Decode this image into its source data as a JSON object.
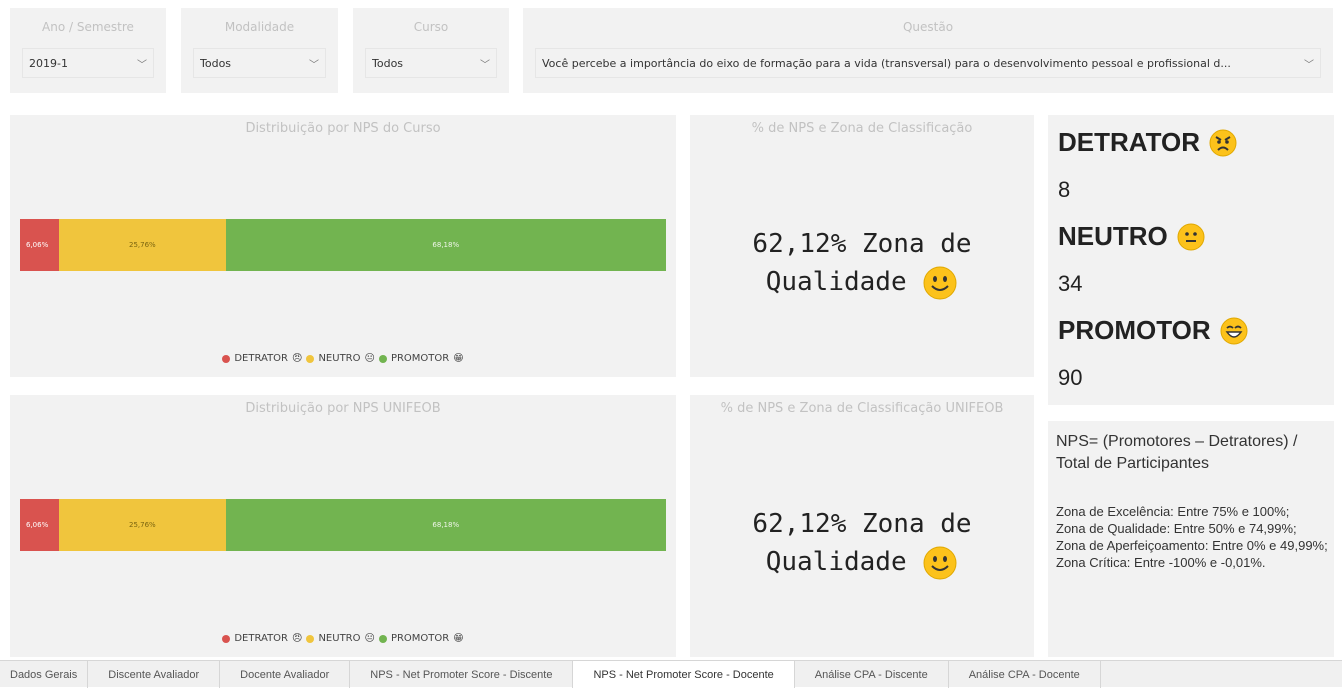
{
  "filters": {
    "ano": {
      "title": "Ano / Semestre",
      "value": "2019-1"
    },
    "modalidade": {
      "title": "Modalidade",
      "value": "Todos"
    },
    "curso": {
      "title": "Curso",
      "value": "Todos"
    },
    "questao": {
      "title": "Questão",
      "value": "Você percebe a importância do eixo de formação para a vida (transversal) para o desenvolvimento pessoal e profissional d..."
    }
  },
  "chart_curso": {
    "title": "Distribuição por NPS do Curso",
    "segments": [
      {
        "label": "6,06%",
        "value": 6.06
      },
      {
        "label": "25,76%",
        "value": 25.76
      },
      {
        "label": "68,18%",
        "value": 68.18
      }
    ]
  },
  "chart_unifeob": {
    "title": "Distribuição por NPS UNIFEOB",
    "segments": [
      {
        "label": "6,06%",
        "value": 6.06
      },
      {
        "label": "25,76%",
        "value": 25.76
      },
      {
        "label": "68,18%",
        "value": 68.18
      }
    ]
  },
  "legend": {
    "detrator": "DETRATOR",
    "neutro": "NEUTRO",
    "promotor": "PROMOTOR"
  },
  "colors": {
    "detrator": "#d9534f",
    "neutro": "#f0c53d",
    "promotor": "#72b450"
  },
  "zona_curso": {
    "title": "% de NPS e Zona de Classificação",
    "line1": "62,12% Zona de",
    "line2": "Qualidade"
  },
  "zona_unifeob": {
    "title": "% de NPS e Zona de Classificação UNIFEOB",
    "line1": "62,12% Zona de",
    "line2": "Qualidade"
  },
  "kpis": {
    "detrator_label": "DETRATOR",
    "detrator_value": "8",
    "neutro_label": "NEUTRO",
    "neutro_value": "34",
    "promotor_label": "PROMOTOR",
    "promotor_value": "90"
  },
  "info": {
    "formula": "NPS= (Promotores – Detratores) / Total de Participantes",
    "z1": "Zona de Excelência: Entre 75% e 100%;",
    "z2": "Zona de Qualidade: Entre 50% e 74,99%;",
    "z3": "Zona de Aperfeiçoamento: Entre 0% e 49,99%;",
    "z4": "Zona Crítica: Entre -100% e -0,01%."
  },
  "tabs": [
    "Dados Gerais",
    "Discente Avaliador",
    "Docente Avaliador",
    "NPS - Net Promoter Score - Discente",
    "NPS - Net Promoter Score - Docente",
    "Análise CPA - Discente",
    "Análise CPA - Docente"
  ],
  "chart_data": [
    {
      "type": "bar",
      "title": "Distribuição por NPS do Curso",
      "series": [
        {
          "name": "DETRATOR",
          "values": [
            6.06
          ]
        },
        {
          "name": "NEUTRO",
          "values": [
            25.76
          ]
        },
        {
          "name": "PROMOTOR",
          "values": [
            68.18
          ]
        }
      ],
      "stacked": true,
      "legend": "bottom"
    },
    {
      "type": "bar",
      "title": "Distribuição por NPS UNIFEOB",
      "series": [
        {
          "name": "DETRATOR",
          "values": [
            6.06
          ]
        },
        {
          "name": "NEUTRO",
          "values": [
            25.76
          ]
        },
        {
          "name": "PROMOTOR",
          "values": [
            68.18
          ]
        }
      ],
      "stacked": true,
      "legend": "bottom"
    }
  ]
}
